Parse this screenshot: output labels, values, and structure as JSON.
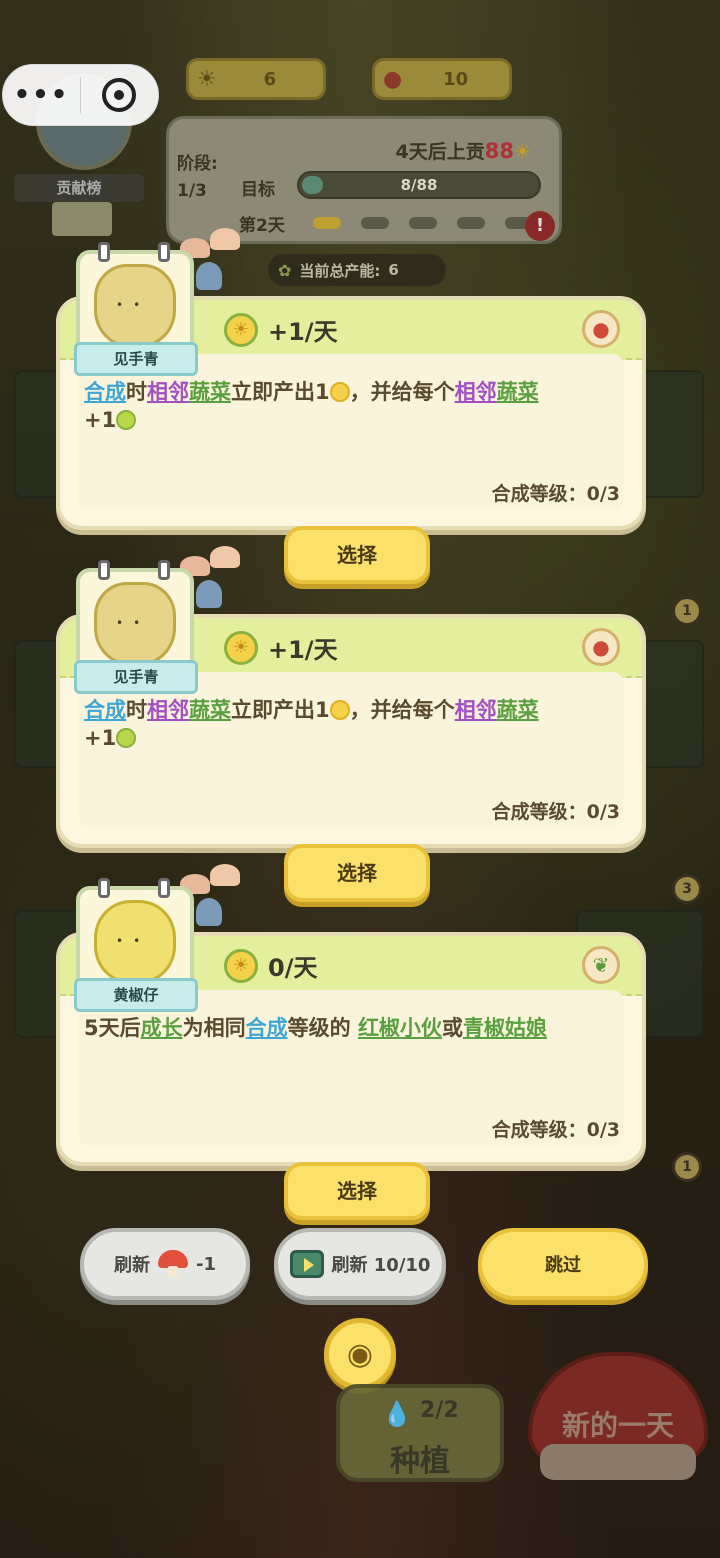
{
  "hud": {
    "sun_count": "6",
    "mushroom_count": "10",
    "leaderboard_label": "贡献榜",
    "stage_label": "阶段:",
    "stage_value": "1/3",
    "deadline_text": "4天后上贡",
    "deadline_amount": "88",
    "goal_label": "目标",
    "goal_progress_text": "8/88",
    "goal_progress_fraction": 0.09,
    "day_label": "第2天",
    "day_pips_filled": 1,
    "day_pips_total": 5,
    "total_production_label": "当前总产能:",
    "total_production_value": "6"
  },
  "cards": [
    {
      "name": "见手青",
      "rate": "+1/天",
      "type_icon": "mushroom-icon",
      "desc_parts": [
        "合成",
        "时",
        "相邻",
        "蔬菜",
        "立即产出1",
        "，并给每个",
        "相邻",
        "蔬菜",
        "+1"
      ],
      "level": "合成等级：0/3",
      "select_label": "选择"
    },
    {
      "name": "见手青",
      "rate": "+1/天",
      "type_icon": "mushroom-icon",
      "desc_parts": [
        "合成",
        "时",
        "相邻",
        "蔬菜",
        "立即产出1",
        "，并给每个",
        "相邻",
        "蔬菜",
        "+1"
      ],
      "level": "合成等级：0/3",
      "select_label": "选择"
    },
    {
      "name": "黄椒仔",
      "rate": "0/天",
      "type_icon": "leaf-icon",
      "desc_parts": [
        "5天后",
        "成长",
        "为相同",
        "合成",
        "等级的 ",
        "红椒小伙",
        "或",
        "青椒姑娘"
      ],
      "level": "合成等级：0/3",
      "select_label": "选择"
    }
  ],
  "side_counts": [
    "1",
    "3",
    "1"
  ],
  "actions": {
    "refresh_mushroom_label": "刷新",
    "refresh_mushroom_cost": "-1",
    "refresh_ad_label": "刷新 10/10",
    "skip_label": "跳过",
    "plant_count": "2/2",
    "plant_label": "种植",
    "new_day_label": "新的一天"
  },
  "colors": {
    "keyword_blue": "#3ea6d4",
    "keyword_purple": "#a24fc4",
    "keyword_green": "#5aa040",
    "button_yellow": "#fbe06a"
  }
}
